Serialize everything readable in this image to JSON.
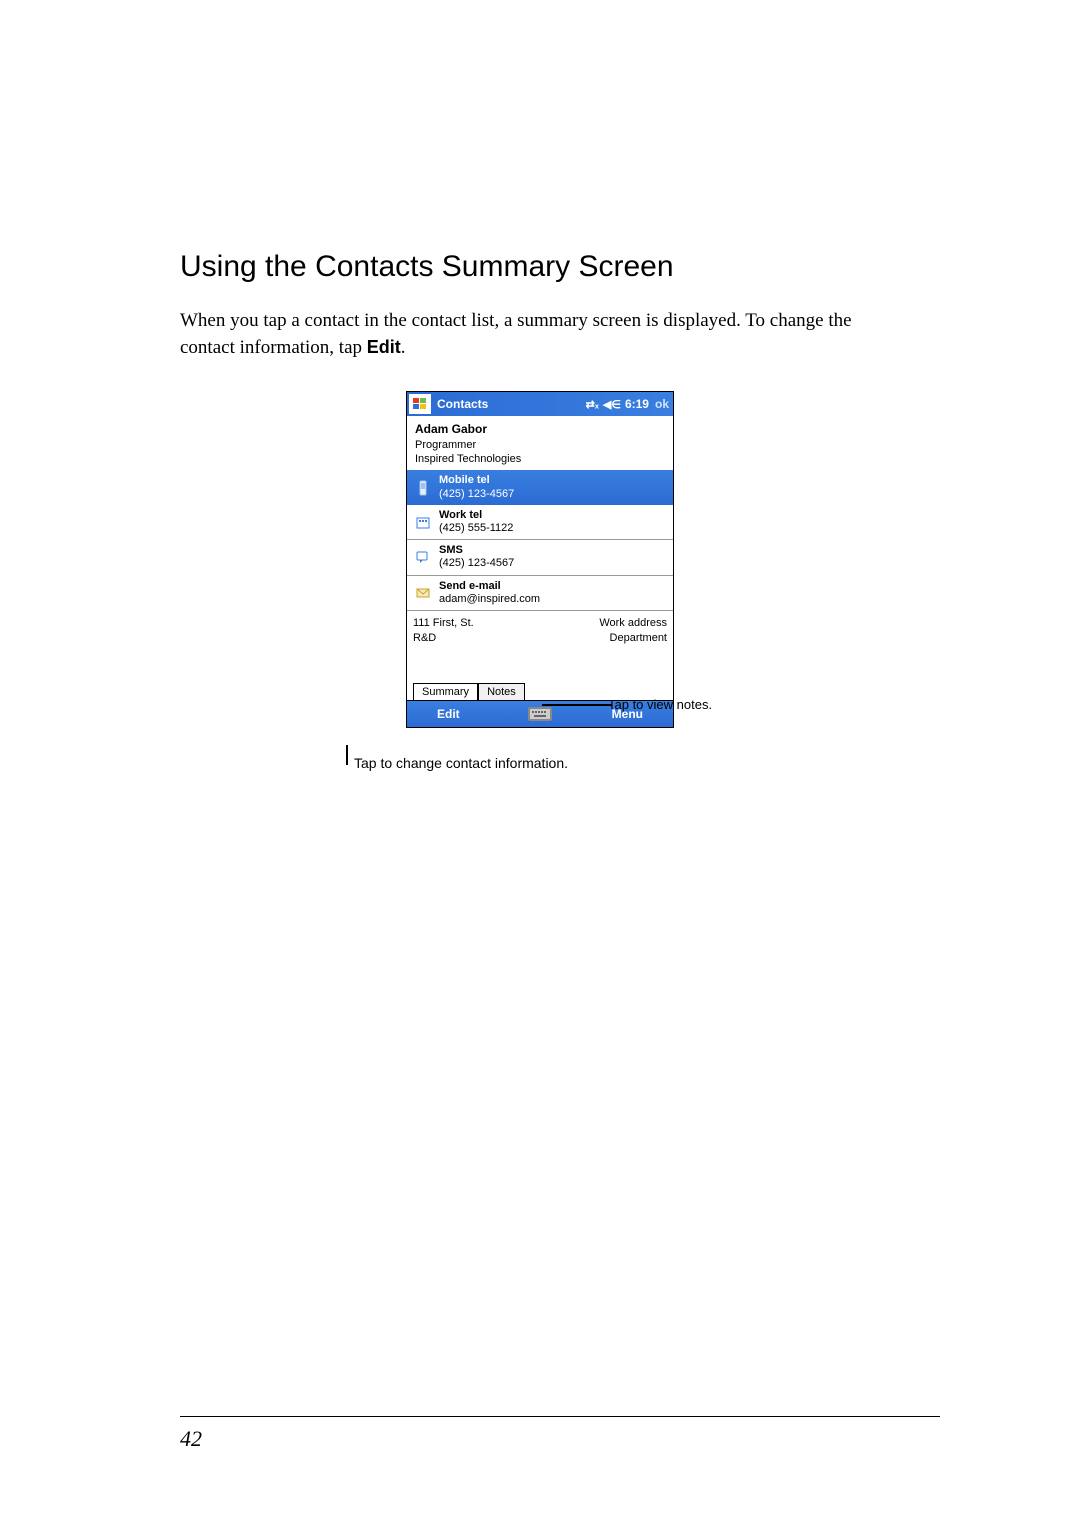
{
  "heading": "Using the Contacts Summary Screen",
  "body_pre": "When you tap a contact in the contact list, a summary screen is displayed. To change the contact information, tap ",
  "body_bold": "Edit",
  "body_post": ".",
  "device": {
    "title": "Contacts",
    "time": "6:19",
    "ok": "ok",
    "contact": {
      "name": "Adam Gabor",
      "title": "Programmer",
      "company": "Inspired Technologies"
    },
    "rows": [
      {
        "icon": "mobile-icon",
        "label": "Mobile tel",
        "value": "(425) 123-4567",
        "selected": true
      },
      {
        "icon": "work-icon",
        "label": "Work tel",
        "value": "(425) 555-1122",
        "selected": false
      },
      {
        "icon": "sms-icon",
        "label": "SMS",
        "value": "(425) 123-4567",
        "selected": false
      },
      {
        "icon": "email-icon",
        "label": "Send e-mail",
        "value": "adam@inspired.com",
        "selected": false
      }
    ],
    "addr": [
      {
        "left": "111 First, St.",
        "right": "Work address"
      },
      {
        "left": "R&D",
        "right": "Department"
      }
    ],
    "tabs": {
      "summary": "Summary",
      "notes": "Notes"
    },
    "bottom": {
      "edit": "Edit",
      "menu": "Menu"
    }
  },
  "callouts": {
    "notes": "Tap to view notes.",
    "edit": "Tap to change contact information."
  },
  "page_number": "42"
}
